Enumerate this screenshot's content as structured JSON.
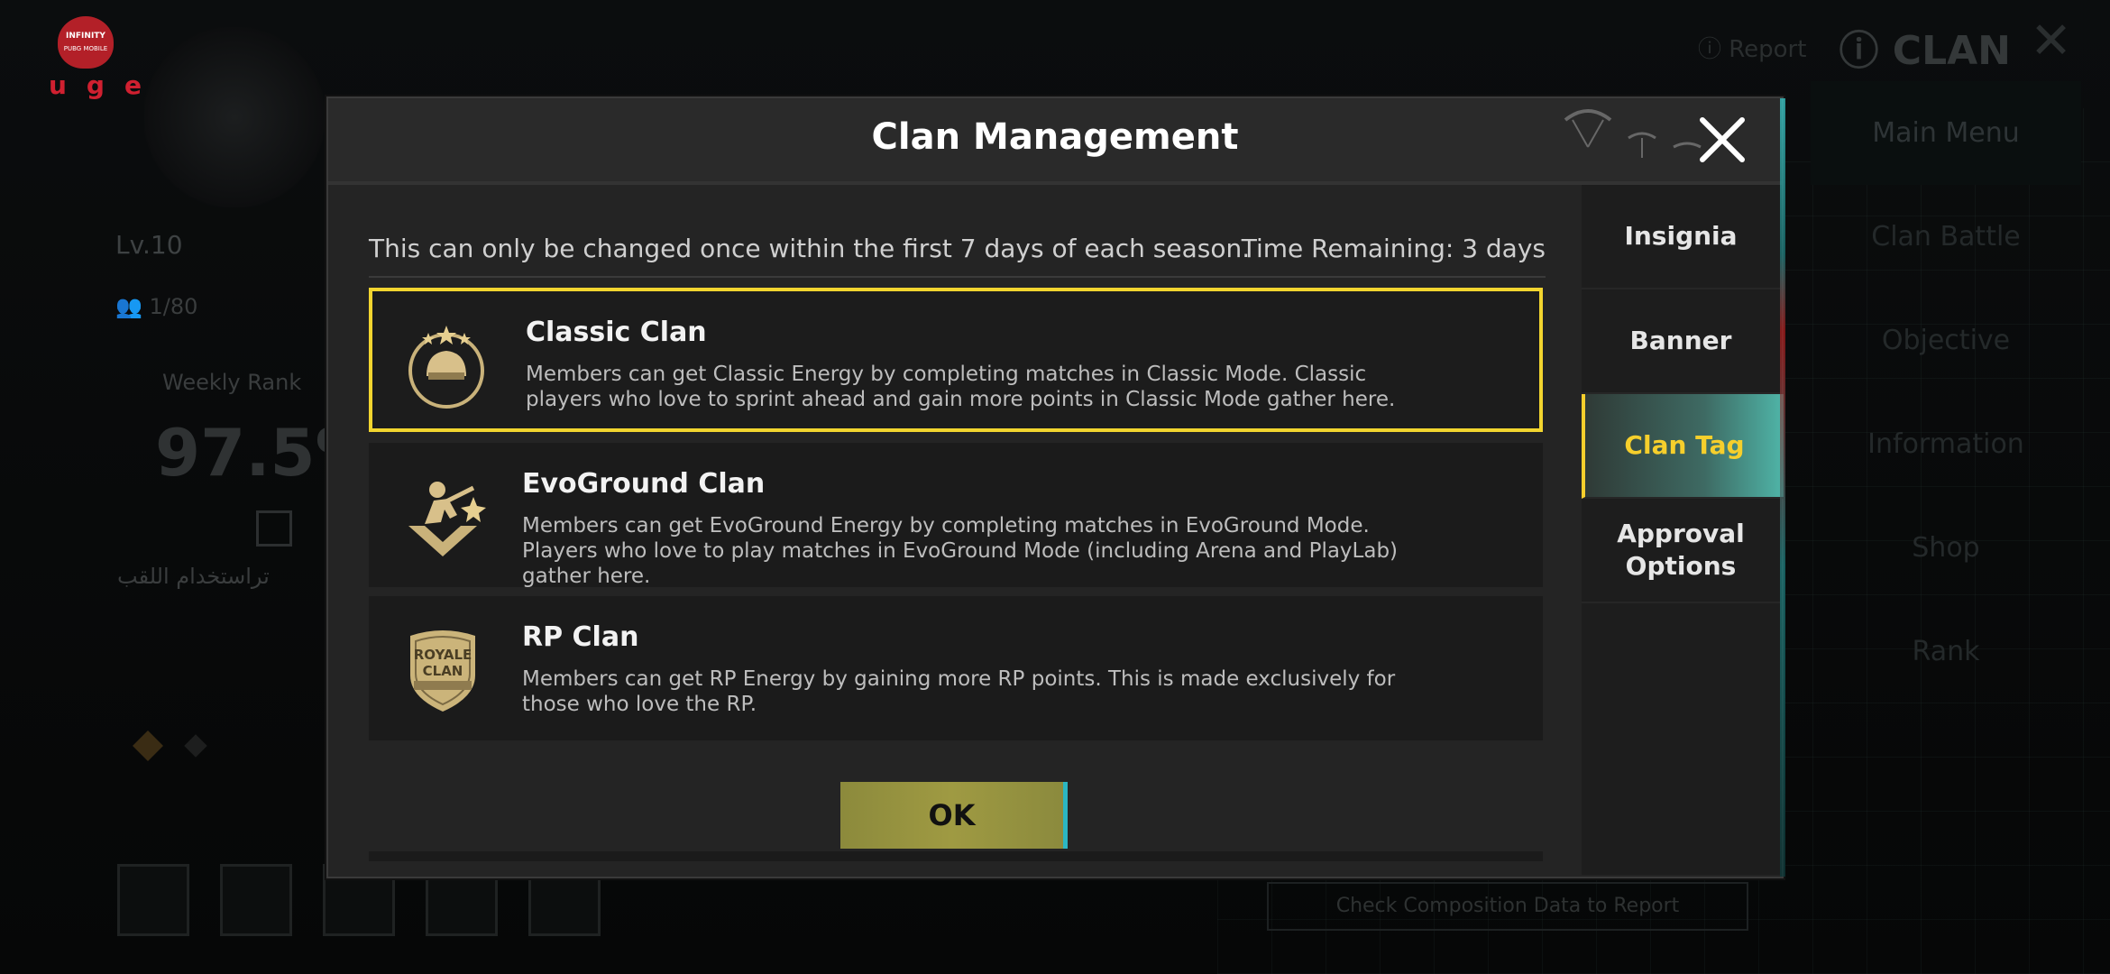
{
  "background": {
    "logo_brand": "INFINITY",
    "logo_sub": "PUBG MOBILE",
    "logo_text": "uge",
    "level": "Lv.10",
    "members": "1/80",
    "weekly_rank_label": "Weekly Rank",
    "weekly_rank_value": "97.5%",
    "arabic_text": "تراستخدام اللقب",
    "top_right_report": "Report",
    "top_right_title": "CLAN",
    "right_menu": [
      "Main Menu",
      "Clan Battle",
      "Objective",
      "Information",
      "Shop",
      "Rank"
    ],
    "bottom_banner": "Check Composition Data to Report"
  },
  "dialog": {
    "title": "Clan Management",
    "notice": "This can only be changed once within the first 7 days of each season.",
    "time_remaining": "Time Remaining: 3 days",
    "options": [
      {
        "icon": "helmet-stars-icon",
        "name": "Classic Clan",
        "description": "Members can get Classic Energy by completing matches in Classic Mode. Classic players who love to sprint ahead and gain more points in Classic Mode gather here.",
        "selected": true
      },
      {
        "icon": "soldier-badge-icon",
        "name": "EvoGround Clan",
        "description": "Members can get EvoGround Energy by completing matches in EvoGround Mode. Players who love to play matches in EvoGround Mode (including Arena and PlayLab) gather here.",
        "selected": false
      },
      {
        "icon": "royale-clan-shield-icon",
        "icon_text_1": "ROYALE",
        "icon_text_2": "CLAN",
        "name": "RP Clan",
        "description": "Members can get RP Energy by gaining more RP points. This is made exclusively for those who love the RP.",
        "selected": false
      }
    ],
    "ok_label": "OK",
    "tabs": [
      {
        "label": "Insignia",
        "active": false
      },
      {
        "label": "Banner",
        "active": false
      },
      {
        "label": "Clan Tag",
        "active": true
      },
      {
        "label": "Approval\nOptions",
        "active": false
      }
    ]
  },
  "colors": {
    "selected_border": "#f2d52f",
    "active_tab_text": "#f6cf2c",
    "ok_button": "#9f9a42",
    "dialog_bg": "#242424"
  }
}
